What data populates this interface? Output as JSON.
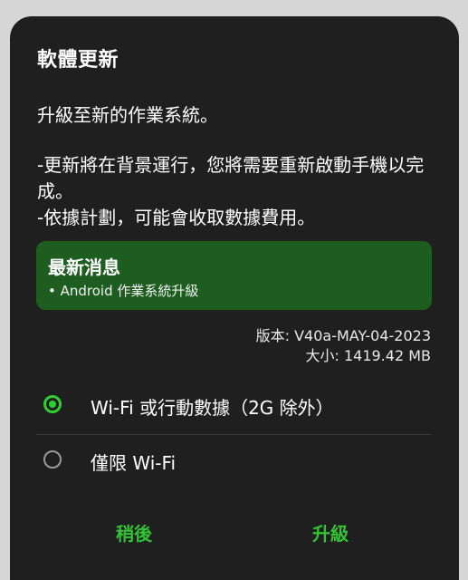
{
  "dialog": {
    "title": "軟體更新",
    "subtitle": "升級至新的作業系統。",
    "description_line1": "-更新將在背景運行，您將需要重新啟動手機以完成。",
    "description_line2": "-依據計劃，可能會收取數據費用。"
  },
  "news": {
    "title": "最新消息",
    "item": "• Android 作業系統升級"
  },
  "meta": {
    "version": "版本: V40a-MAY-04-2023",
    "size": "大小: 1419.42 MB"
  },
  "options": [
    {
      "label": "Wi-Fi 或行動數據（2G 除外）",
      "selected": true
    },
    {
      "label": "僅限 Wi-Fi",
      "selected": false
    }
  ],
  "buttons": {
    "later": "稍後",
    "upgrade": "升級"
  },
  "colors": {
    "dialog_bg": "#1f1f1f",
    "accent_green": "#2ecf2e",
    "news_bg": "#1e5d20"
  }
}
